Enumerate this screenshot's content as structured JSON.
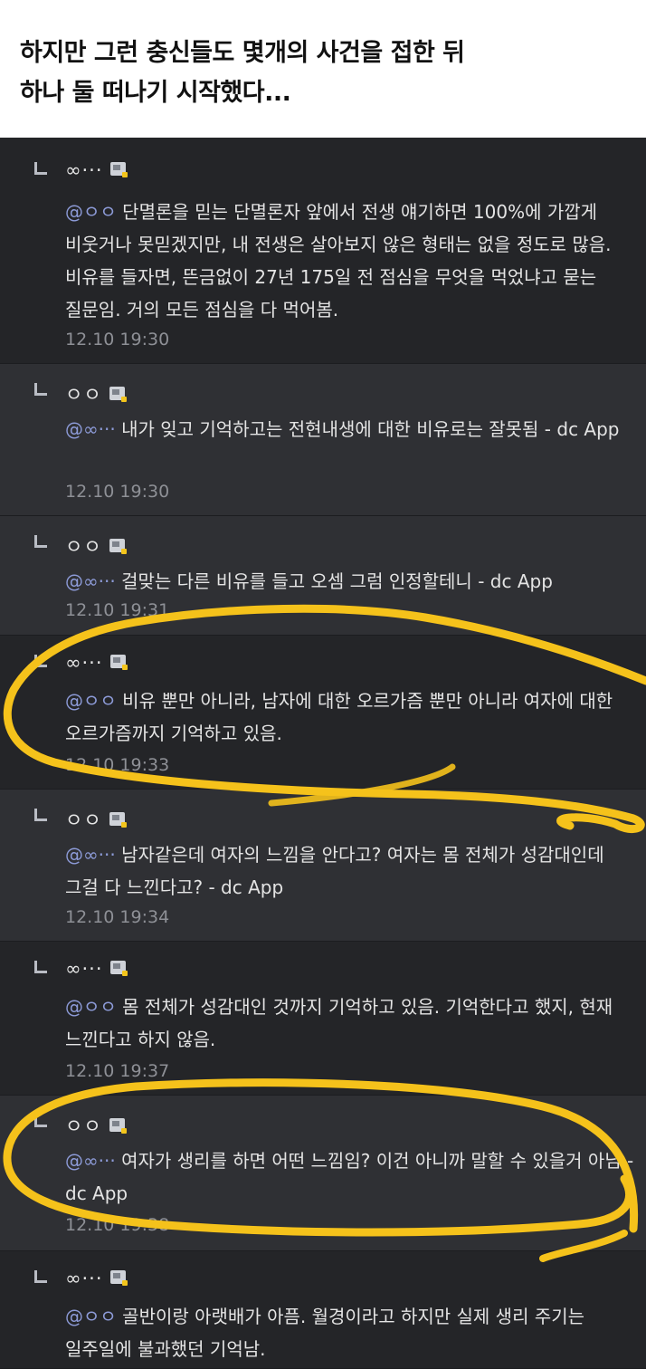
{
  "caption": {
    "line1": "하지만 그런 충신들도 몇개의 사건을 접한 뒤",
    "line2": "하나 둘 떠나기 시작했다..."
  },
  "comments": [
    {
      "nick": "∞···",
      "mention": "@ㅇㅇ",
      "text": " 단멸론을 믿는 단멸론자 앞에서 전생 얘기하면 100%에 가깝게 비웃거나 못믿겠지만, 내 전생은 살아보지 않은 형태는 없을 정도로 많음. 비유를 들자면, 뜬금없이 27년 175일 전 점심을 무엇을 먹었냐고 묻는 질문임. 거의 모든 점심을 다 먹어봄.",
      "time": "12.10 19:30"
    },
    {
      "nick": "ㅇㅇ",
      "mention": "@∞···",
      "text": " 내가 잊고 기억하고는 전현내생에 대한 비유로는 잘못됨 - dc App",
      "time": "12.10 19:30"
    },
    {
      "nick": "ㅇㅇ",
      "mention": "@∞···",
      "text": " 걸맞는 다른 비유를 들고 오셈 그럼 인정할테니 - dc App",
      "time": "12.10 19:31"
    },
    {
      "nick": "∞···",
      "mention": "@ㅇㅇ",
      "text": " 비유 뿐만 아니라, 남자에 대한 오르가즘 뿐만 아니라 여자에 대한 오르가즘까지 기억하고 있음.",
      "time": "12.10 19:33"
    },
    {
      "nick": "ㅇㅇ",
      "mention": "@∞···",
      "text": " 남자같은데 여자의 느낌을 안다고? 여자는 몸 전체가 성감대인데 그걸 다 느낀다고? - dc App",
      "time": "12.10 19:34"
    },
    {
      "nick": "∞···",
      "mention": "@ㅇㅇ",
      "text": " 몸 전체가 성감대인 것까지 기억하고 있음. 기억한다고 했지, 현재 느낀다고 하지 않음.",
      "time": "12.10 19:37"
    },
    {
      "nick": "ㅇㅇ",
      "mention": "@∞···",
      "text": " 여자가 생리를 하면 어떤 느낌임? 이건 아니까 말할 수 있을거 아님 - dc App",
      "time": "12.10 19:38"
    },
    {
      "nick": "∞···",
      "mention": "@ㅇㅇ",
      "text": " 골반이랑 아랫배가 아픔. 월경이라고 하지만 실제 생리 주기는 일주일에 불과했던 기억남.",
      "time": ""
    }
  ],
  "colors": {
    "highlight": "#f5c21b",
    "mention": "#8d9bd8",
    "background": "#2b2c30"
  }
}
